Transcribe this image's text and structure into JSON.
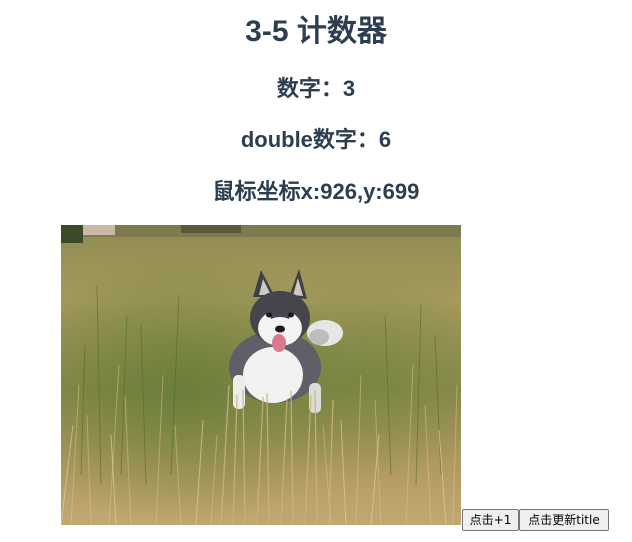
{
  "title": "3-5 计数器",
  "count": {
    "label": "数字：",
    "value": "3"
  },
  "double": {
    "label": "double数字：",
    "value": "6"
  },
  "mouse": {
    "label": "鼠标坐标",
    "x_label": "x:",
    "x": "926",
    "separator": ",",
    "y_label": "y:",
    "y": "699"
  },
  "image": {
    "subject": "husky dog running in tall grass field"
  },
  "buttons": {
    "increment_label": "点击+1",
    "update_title_label": "点击更新title"
  }
}
